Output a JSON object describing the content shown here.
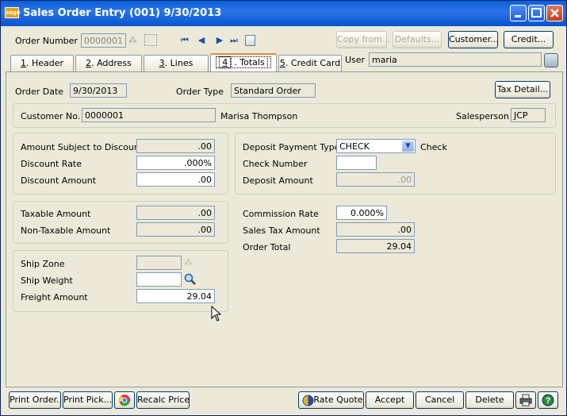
{
  "window": {
    "title": "Sales Order Entry (001) 9/30/2013",
    "app_icon_text": "sage"
  },
  "header": {
    "order_number_label": "Order Number",
    "order_number_value": "0000001",
    "copy_from": "Copy from...",
    "defaults": "Defaults...",
    "customer": "Customer...",
    "credit": "Credit..."
  },
  "tabs": [
    {
      "num": "1",
      "label": ". Header"
    },
    {
      "num": "2",
      "label": ". Address"
    },
    {
      "num": "3",
      "label": ". Lines"
    },
    {
      "num": "4",
      "label": ". Totals"
    },
    {
      "num": "5",
      "label": ". Credit Card"
    }
  ],
  "user": {
    "label": "User",
    "value": "maria"
  },
  "order": {
    "order_date_label": "Order Date",
    "order_date": "9/30/2013",
    "order_type_label": "Order Type",
    "order_type": "Standard Order",
    "tax_detail": "Tax Detail..."
  },
  "customer": {
    "label": "Customer No.",
    "number": "0000001",
    "name": "Marisa Thompson",
    "salesperson_label": "Salesperson",
    "salesperson": "JCP"
  },
  "discount": {
    "amount_subject_label": "Amount Subject to Discount",
    "amount_subject": ".00",
    "rate_label": "Discount Rate",
    "rate": ".000%",
    "amount_label": "Discount Amount",
    "amount": ".00"
  },
  "deposit": {
    "payment_type_label": "Deposit Payment Type",
    "payment_type": "CHECK",
    "payment_type_desc": "Check",
    "check_number_label": "Check Number",
    "check_number": "",
    "amount_label": "Deposit Amount",
    "amount": ".00"
  },
  "tax": {
    "taxable_label": "Taxable Amount",
    "taxable": ".00",
    "nontaxable_label": "Non-Taxable Amount",
    "nontaxable": ".00"
  },
  "totals": {
    "commission_label": "Commission Rate",
    "commission": "0.000%",
    "sales_tax_label": "Sales Tax Amount",
    "sales_tax": ".00",
    "order_total_label": "Order Total",
    "order_total": "29.04"
  },
  "shipping": {
    "zone_label": "Ship Zone",
    "zone": "",
    "weight_label": "Ship Weight",
    "weight": "",
    "freight_label": "Freight Amount",
    "freight": "29.04"
  },
  "footer": {
    "print_order": "Print Order...",
    "print_pick": "Print Pick...",
    "recalc_price": "Recalc Price",
    "rate_quote": "Rate Quote",
    "accept": "Accept",
    "cancel": "Cancel",
    "delete": "Delete"
  }
}
